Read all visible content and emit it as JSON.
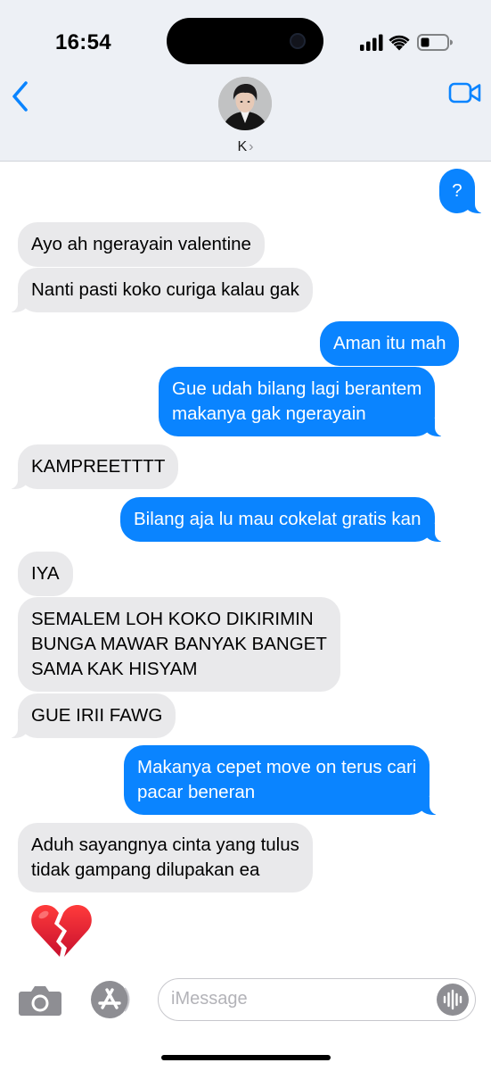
{
  "status_bar": {
    "time": "16:54",
    "icons": [
      "signal-icon",
      "wifi-icon",
      "battery-icon"
    ]
  },
  "header": {
    "back_icon": "chevron-left-icon",
    "video_icon": "video-camera-icon",
    "contact_name": "K",
    "contact_chevron": "›"
  },
  "colors": {
    "outgoing": "#0a84ff",
    "incoming": "#e9e9eb",
    "accent": "#0a84ff"
  },
  "messages": [
    {
      "direction": "outgoing",
      "text": "?"
    },
    {
      "direction": "incoming",
      "text": "Ayo ah ngerayain valentine"
    },
    {
      "direction": "incoming",
      "text": "Nanti pasti koko curiga kalau gak"
    },
    {
      "direction": "outgoing",
      "text": "Aman itu mah"
    },
    {
      "direction": "outgoing",
      "lines": [
        "Gue udah bilang lagi berantem",
        "makanya gak ngerayain"
      ]
    },
    {
      "direction": "incoming",
      "text": "KAMPREETTTT"
    },
    {
      "direction": "outgoing",
      "text": "Bilang aja lu mau cokelat gratis kan"
    },
    {
      "direction": "incoming",
      "text": "IYA"
    },
    {
      "direction": "incoming",
      "lines": [
        "SEMALEM LOH KOKO DIKIRIMIN",
        "BUNGA MAWAR BANYAK BANGET",
        "SAMA KAK HISYAM"
      ]
    },
    {
      "direction": "incoming",
      "text": "GUE IRII FAWG"
    },
    {
      "direction": "outgoing",
      "lines": [
        "Makanya cepet move on terus cari",
        "pacar beneran"
      ]
    },
    {
      "direction": "incoming",
      "lines": [
        "Aduh sayangnya cinta yang tulus",
        "tidak gampang dilupakan ea"
      ]
    },
    {
      "direction": "incoming",
      "emoji": "broken-heart-icon"
    }
  ],
  "input_bar": {
    "camera_icon": "camera-icon",
    "apps_icon": "app-store-icon",
    "placeholder": "iMessage",
    "audio_icon": "audio-waveform-icon"
  }
}
